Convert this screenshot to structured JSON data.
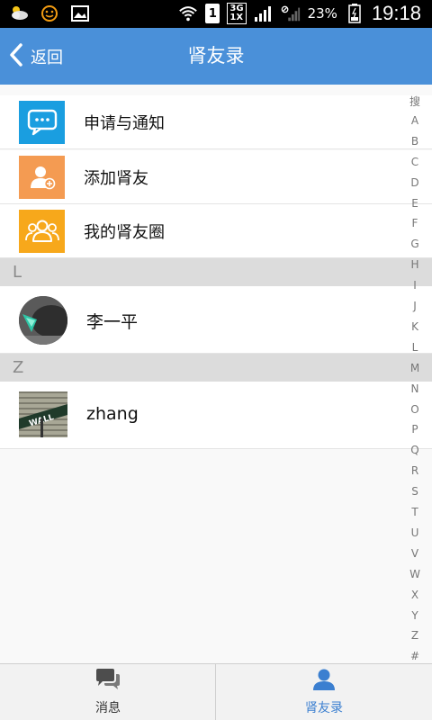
{
  "status_bar": {
    "left_icons": [
      "weather-icon",
      "emoji-icon",
      "image-icon"
    ],
    "sim_slot": "1",
    "network_top": "3G",
    "network_bottom": "1X",
    "battery_percent": "23%",
    "time": "19:18"
  },
  "header": {
    "back_label": "返回",
    "title": "肾友录"
  },
  "fixed_items": [
    {
      "label": "申请与通知",
      "icon": "chat-bubble-icon",
      "color": "#1a9ee0"
    },
    {
      "label": "添加肾友",
      "icon": "add-user-icon",
      "color": "#f49b52"
    },
    {
      "label": "我的肾友圈",
      "icon": "group-icon",
      "color": "#f7a81b"
    }
  ],
  "sections": [
    {
      "letter": "L",
      "contacts": [
        {
          "name": "李一平",
          "avatar": "avatar-round-icon"
        }
      ]
    },
    {
      "letter": "Z",
      "contacts": [
        {
          "name": "zhang",
          "avatar": "wall-street-sign-icon"
        }
      ]
    }
  ],
  "index": [
    "搜",
    "A",
    "B",
    "C",
    "D",
    "E",
    "F",
    "G",
    "H",
    "I",
    "J",
    "K",
    "L",
    "M",
    "N",
    "O",
    "P",
    "Q",
    "R",
    "S",
    "T",
    "U",
    "V",
    "W",
    "X",
    "Y",
    "Z",
    "#"
  ],
  "tabs": [
    {
      "label": "消息",
      "icon": "message-bubbles-icon",
      "active": false
    },
    {
      "label": "肾友录",
      "icon": "person-icon",
      "active": true
    }
  ],
  "colors": {
    "header_bg": "#4a90d9",
    "active_tab": "#3b7fd0",
    "inactive_tab": "#333333"
  }
}
